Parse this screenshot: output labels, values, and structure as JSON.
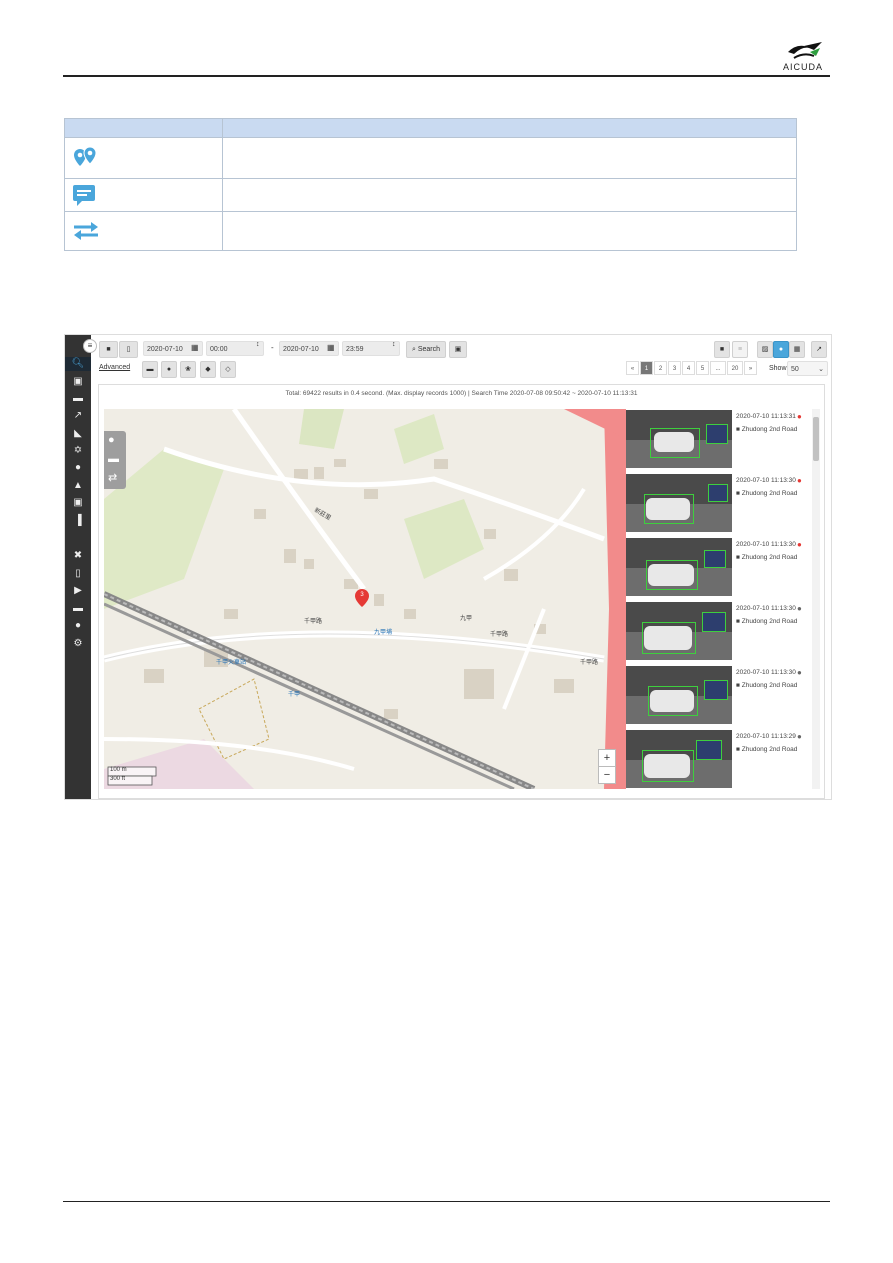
{
  "brand": {
    "logo_text": "AICUDA"
  },
  "icon_table": {
    "rows": [
      {
        "icon": "map-pins-icon",
        "description": ""
      },
      {
        "icon": "message-icon",
        "description": ""
      },
      {
        "icon": "swap-arrows-icon",
        "description": ""
      }
    ]
  },
  "toolbar": {
    "date_from": "2020-07-10",
    "time_from": "00:00",
    "separator": "-",
    "date_to": "2020-07-10",
    "time_to": "23:59",
    "search_label": "Search",
    "advanced_label": "Advanced",
    "show_label": "Show",
    "show_value": "50"
  },
  "pagination": {
    "prev": "«",
    "pages": [
      "1",
      "2",
      "3",
      "4",
      "5",
      "...",
      "20"
    ],
    "next": "»",
    "current": "1"
  },
  "status_text": "Total: 69422 results in 0.4 second. (Max. display records 1000) | Search Time 2020-07-08 09:50:42 ~ 2020-07-10 11:13:31",
  "map": {
    "cluster_count": "3",
    "zoom_in": "+",
    "zoom_out": "−",
    "scale_m": "100 m",
    "scale_ft": "300 ft",
    "labels": [
      "千甲路",
      "千甲路",
      "千甲路",
      "千甲路",
      "新莊里",
      "九甲",
      "千甲火車站",
      "九甲埔",
      "千甲"
    ]
  },
  "results": [
    {
      "time": "2020-07-10 11:13:31",
      "camera": "Zhudong 2nd Road",
      "pin_color": "#e53935"
    },
    {
      "time": "2020-07-10 11:13:30",
      "camera": "Zhudong 2nd Road",
      "pin_color": "#e53935"
    },
    {
      "time": "2020-07-10 11:13:30",
      "camera": "Zhudong 2nd Road",
      "pin_color": "#e53935"
    },
    {
      "time": "2020-07-10 11:13:30",
      "camera": "Zhudong 2nd Road",
      "pin_color": "#666666"
    },
    {
      "time": "2020-07-10 11:13:30",
      "camera": "Zhudong 2nd Road",
      "pin_color": "#666666"
    },
    {
      "time": "2020-07-10 11:13:29",
      "camera": "Zhudong 2nd Road",
      "pin_color": "#666666"
    }
  ],
  "colors": {
    "accent": "#4aa6db",
    "sidebar": "#333333",
    "marker": "#e53935"
  }
}
